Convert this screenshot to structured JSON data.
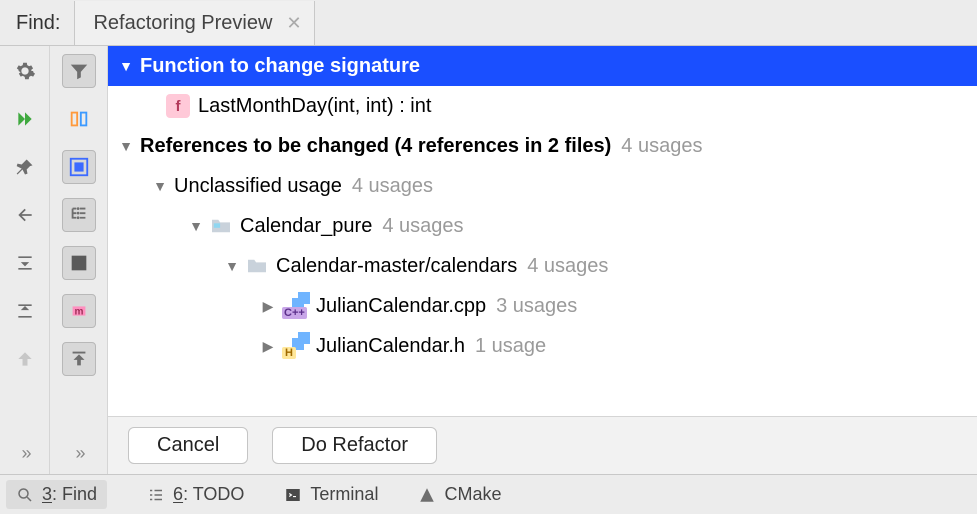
{
  "header": {
    "find_label": "Find:",
    "tab_title": "Refactoring Preview"
  },
  "tree": {
    "title": "Function to change signature",
    "signature": "LastMonthDay(int, int) : int",
    "refs_heading": "References to be changed  (4 references in 2 files)",
    "refs_count": "4 usages",
    "unclassified_label": "Unclassified usage",
    "unclassified_count": "4 usages",
    "project_name": "Calendar_pure",
    "project_count": "4 usages",
    "folder_name": "Calendar-master/calendars",
    "folder_count": "4 usages",
    "file1_name": "JulianCalendar.cpp",
    "file1_count": "3 usages",
    "file2_name": "JulianCalendar.h",
    "file2_count": "1 usage"
  },
  "buttons": {
    "cancel": "Cancel",
    "do_refactor": "Do Refactor"
  },
  "footer": {
    "find_num": "3",
    "find_label": ": Find",
    "todo_num": "6",
    "todo_label": ": TODO",
    "terminal": "Terminal",
    "cmake": "CMake"
  }
}
